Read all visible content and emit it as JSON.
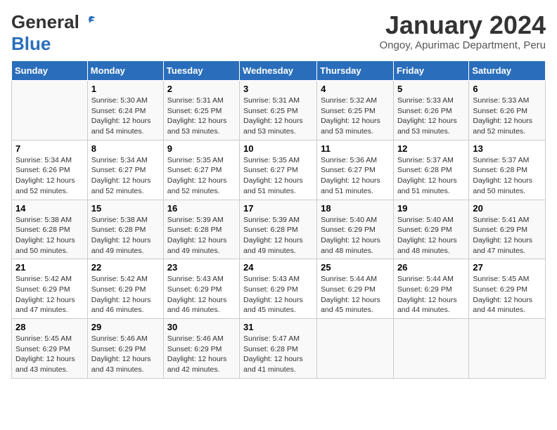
{
  "logo": {
    "general": "General",
    "blue": "Blue"
  },
  "title": "January 2024",
  "subtitle": "Ongoy, Apurimac Department, Peru",
  "days_of_week": [
    "Sunday",
    "Monday",
    "Tuesday",
    "Wednesday",
    "Thursday",
    "Friday",
    "Saturday"
  ],
  "weeks": [
    [
      {
        "day": "",
        "sunrise": "",
        "sunset": "",
        "daylight": ""
      },
      {
        "day": "1",
        "sunrise": "Sunrise: 5:30 AM",
        "sunset": "Sunset: 6:24 PM",
        "daylight": "Daylight: 12 hours and 54 minutes."
      },
      {
        "day": "2",
        "sunrise": "Sunrise: 5:31 AM",
        "sunset": "Sunset: 6:25 PM",
        "daylight": "Daylight: 12 hours and 53 minutes."
      },
      {
        "day": "3",
        "sunrise": "Sunrise: 5:31 AM",
        "sunset": "Sunset: 6:25 PM",
        "daylight": "Daylight: 12 hours and 53 minutes."
      },
      {
        "day": "4",
        "sunrise": "Sunrise: 5:32 AM",
        "sunset": "Sunset: 6:25 PM",
        "daylight": "Daylight: 12 hours and 53 minutes."
      },
      {
        "day": "5",
        "sunrise": "Sunrise: 5:33 AM",
        "sunset": "Sunset: 6:26 PM",
        "daylight": "Daylight: 12 hours and 53 minutes."
      },
      {
        "day": "6",
        "sunrise": "Sunrise: 5:33 AM",
        "sunset": "Sunset: 6:26 PM",
        "daylight": "Daylight: 12 hours and 52 minutes."
      }
    ],
    [
      {
        "day": "7",
        "sunrise": "Sunrise: 5:34 AM",
        "sunset": "Sunset: 6:26 PM",
        "daylight": "Daylight: 12 hours and 52 minutes."
      },
      {
        "day": "8",
        "sunrise": "Sunrise: 5:34 AM",
        "sunset": "Sunset: 6:27 PM",
        "daylight": "Daylight: 12 hours and 52 minutes."
      },
      {
        "day": "9",
        "sunrise": "Sunrise: 5:35 AM",
        "sunset": "Sunset: 6:27 PM",
        "daylight": "Daylight: 12 hours and 52 minutes."
      },
      {
        "day": "10",
        "sunrise": "Sunrise: 5:35 AM",
        "sunset": "Sunset: 6:27 PM",
        "daylight": "Daylight: 12 hours and 51 minutes."
      },
      {
        "day": "11",
        "sunrise": "Sunrise: 5:36 AM",
        "sunset": "Sunset: 6:27 PM",
        "daylight": "Daylight: 12 hours and 51 minutes."
      },
      {
        "day": "12",
        "sunrise": "Sunrise: 5:37 AM",
        "sunset": "Sunset: 6:28 PM",
        "daylight": "Daylight: 12 hours and 51 minutes."
      },
      {
        "day": "13",
        "sunrise": "Sunrise: 5:37 AM",
        "sunset": "Sunset: 6:28 PM",
        "daylight": "Daylight: 12 hours and 50 minutes."
      }
    ],
    [
      {
        "day": "14",
        "sunrise": "Sunrise: 5:38 AM",
        "sunset": "Sunset: 6:28 PM",
        "daylight": "Daylight: 12 hours and 50 minutes."
      },
      {
        "day": "15",
        "sunrise": "Sunrise: 5:38 AM",
        "sunset": "Sunset: 6:28 PM",
        "daylight": "Daylight: 12 hours and 49 minutes."
      },
      {
        "day": "16",
        "sunrise": "Sunrise: 5:39 AM",
        "sunset": "Sunset: 6:28 PM",
        "daylight": "Daylight: 12 hours and 49 minutes."
      },
      {
        "day": "17",
        "sunrise": "Sunrise: 5:39 AM",
        "sunset": "Sunset: 6:28 PM",
        "daylight": "Daylight: 12 hours and 49 minutes."
      },
      {
        "day": "18",
        "sunrise": "Sunrise: 5:40 AM",
        "sunset": "Sunset: 6:29 PM",
        "daylight": "Daylight: 12 hours and 48 minutes."
      },
      {
        "day": "19",
        "sunrise": "Sunrise: 5:40 AM",
        "sunset": "Sunset: 6:29 PM",
        "daylight": "Daylight: 12 hours and 48 minutes."
      },
      {
        "day": "20",
        "sunrise": "Sunrise: 5:41 AM",
        "sunset": "Sunset: 6:29 PM",
        "daylight": "Daylight: 12 hours and 47 minutes."
      }
    ],
    [
      {
        "day": "21",
        "sunrise": "Sunrise: 5:42 AM",
        "sunset": "Sunset: 6:29 PM",
        "daylight": "Daylight: 12 hours and 47 minutes."
      },
      {
        "day": "22",
        "sunrise": "Sunrise: 5:42 AM",
        "sunset": "Sunset: 6:29 PM",
        "daylight": "Daylight: 12 hours and 46 minutes."
      },
      {
        "day": "23",
        "sunrise": "Sunrise: 5:43 AM",
        "sunset": "Sunset: 6:29 PM",
        "daylight": "Daylight: 12 hours and 46 minutes."
      },
      {
        "day": "24",
        "sunrise": "Sunrise: 5:43 AM",
        "sunset": "Sunset: 6:29 PM",
        "daylight": "Daylight: 12 hours and 45 minutes."
      },
      {
        "day": "25",
        "sunrise": "Sunrise: 5:44 AM",
        "sunset": "Sunset: 6:29 PM",
        "daylight": "Daylight: 12 hours and 45 minutes."
      },
      {
        "day": "26",
        "sunrise": "Sunrise: 5:44 AM",
        "sunset": "Sunset: 6:29 PM",
        "daylight": "Daylight: 12 hours and 44 minutes."
      },
      {
        "day": "27",
        "sunrise": "Sunrise: 5:45 AM",
        "sunset": "Sunset: 6:29 PM",
        "daylight": "Daylight: 12 hours and 44 minutes."
      }
    ],
    [
      {
        "day": "28",
        "sunrise": "Sunrise: 5:45 AM",
        "sunset": "Sunset: 6:29 PM",
        "daylight": "Daylight: 12 hours and 43 minutes."
      },
      {
        "day": "29",
        "sunrise": "Sunrise: 5:46 AM",
        "sunset": "Sunset: 6:29 PM",
        "daylight": "Daylight: 12 hours and 43 minutes."
      },
      {
        "day": "30",
        "sunrise": "Sunrise: 5:46 AM",
        "sunset": "Sunset: 6:29 PM",
        "daylight": "Daylight: 12 hours and 42 minutes."
      },
      {
        "day": "31",
        "sunrise": "Sunrise: 5:47 AM",
        "sunset": "Sunset: 6:28 PM",
        "daylight": "Daylight: 12 hours and 41 minutes."
      },
      {
        "day": "",
        "sunrise": "",
        "sunset": "",
        "daylight": ""
      },
      {
        "day": "",
        "sunrise": "",
        "sunset": "",
        "daylight": ""
      },
      {
        "day": "",
        "sunrise": "",
        "sunset": "",
        "daylight": ""
      }
    ]
  ]
}
